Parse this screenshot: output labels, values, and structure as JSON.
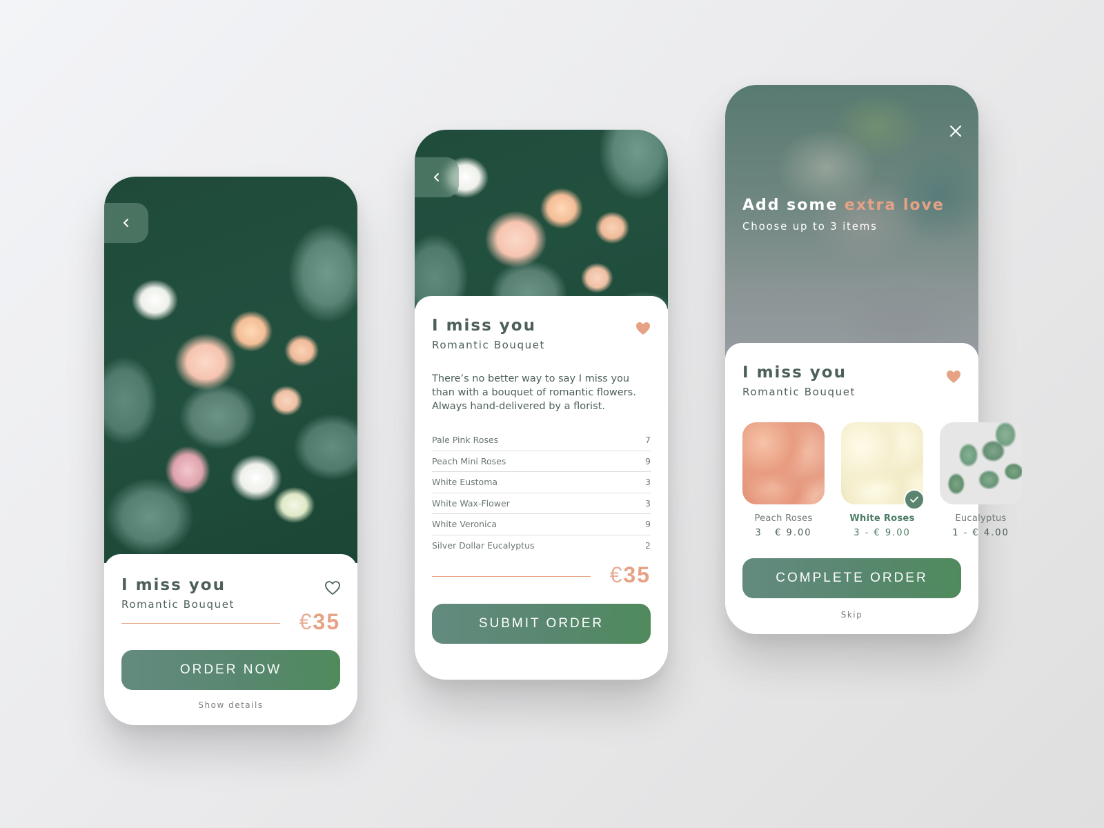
{
  "colors": {
    "accent": "#e5a285",
    "primary_green": "#58876f",
    "text_dark": "#4c5f5a",
    "background": "#ececee"
  },
  "product": {
    "title": "I miss you",
    "subtitle": "Romantic Bouquet",
    "currency": "€",
    "price": "35"
  },
  "screen1": {
    "back_icon": "chevron-left-icon",
    "favorite_icon": "heart-outline-icon",
    "favorited": false,
    "cta_label": "ORDER NOW",
    "details_link": "Show details"
  },
  "screen2": {
    "back_icon": "chevron-left-icon",
    "favorite_icon": "heart-filled-icon",
    "favorited": true,
    "description": "There’s no better way to say I miss you than with a bouquet of romantic flowers. Always hand-delivered by a florist.",
    "ingredients": [
      {
        "name": "Pale Pink Roses",
        "qty": "7"
      },
      {
        "name": "Peach Mini Roses",
        "qty": "9"
      },
      {
        "name": "White Eustoma",
        "qty": "3"
      },
      {
        "name": "White Wax-Flower",
        "qty": "3"
      },
      {
        "name": "White Veronica",
        "qty": "9"
      },
      {
        "name": "Silver Dollar Eucalyptus",
        "qty": "2"
      }
    ],
    "cta_label": "SUBMIT ORDER"
  },
  "screen3": {
    "close_icon": "close-icon",
    "heading_prefix": "Add some ",
    "heading_accent": "extra love",
    "subheading": "Choose up to 3 items",
    "favorite_icon": "heart-filled-icon",
    "favorited": true,
    "addons": [
      {
        "name": "Peach Roses",
        "price": "3   € 9.00",
        "selected": false
      },
      {
        "name": "White Roses",
        "price": "3 - € 9.00",
        "selected": true
      },
      {
        "name": "Eucalyptus",
        "price": "1 - € 4.00",
        "selected": false
      }
    ],
    "cta_label": "COMPLETE ORDER",
    "skip_link": "Skip"
  }
}
